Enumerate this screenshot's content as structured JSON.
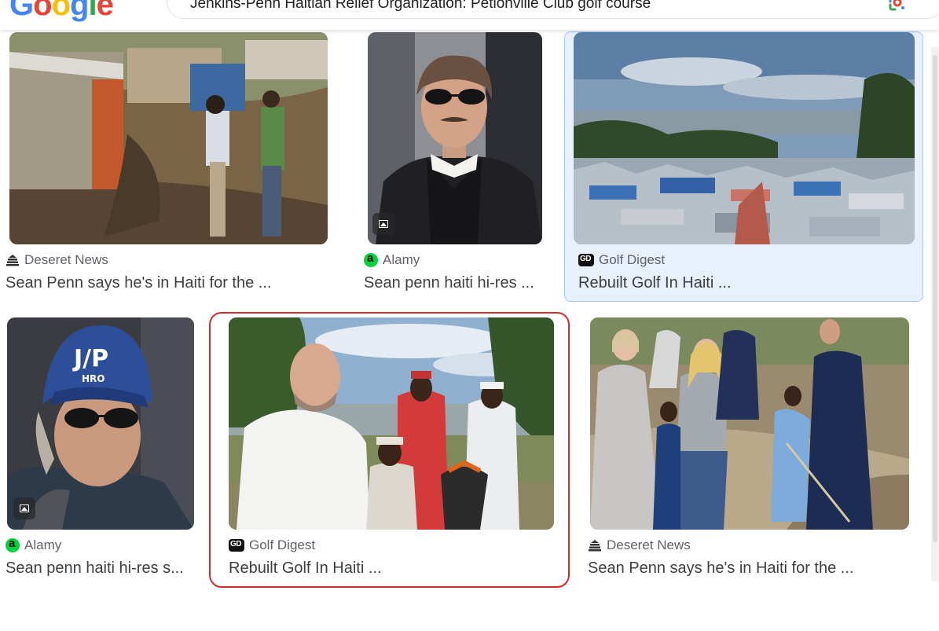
{
  "header": {
    "logo_letters": [
      "G",
      "o",
      "o",
      "g",
      "l",
      "e"
    ],
    "search_query": "Jenkins-Penn Haitian Relief Organization: Petionville Club golf course",
    "lens_icon": "google-lens-icon"
  },
  "results": [
    {
      "source": "Deseret News",
      "title": "Sean Penn says he's in Haiti for the ...",
      "favicon": "deseret-news-icon",
      "image": "tent-camp-hillside-photo"
    },
    {
      "source": "Alamy",
      "title": "Sean penn haiti hi-res ...",
      "favicon": "alamy-icon",
      "image": "sean-penn-portrait-photo"
    },
    {
      "source": "Golf Digest",
      "title": "Rebuilt Golf In Haiti ...",
      "favicon": "golf-digest-icon",
      "image": "tent-city-panorama-photo",
      "selected": true
    },
    {
      "source": "Alamy",
      "title": "Sean penn haiti hi-res s...",
      "favicon": "alamy-icon",
      "image": "sean-penn-jp-hro-cap-photo"
    },
    {
      "source": "Golf Digest",
      "title": "Rebuilt Golf In Haiti ...",
      "favicon": "golf-digest-icon",
      "image": "golfers-group-photo",
      "highlighted": true
    },
    {
      "source": "Deseret News",
      "title": "Sean Penn says he's in Haiti for the ...",
      "favicon": "deseret-news-icon",
      "image": "group-walking-dirt-path-photo"
    }
  ],
  "colors": {
    "selected_background": "#e8f0fe",
    "highlight_border": "#d12c2c",
    "alamy_green": "#00d13c"
  }
}
